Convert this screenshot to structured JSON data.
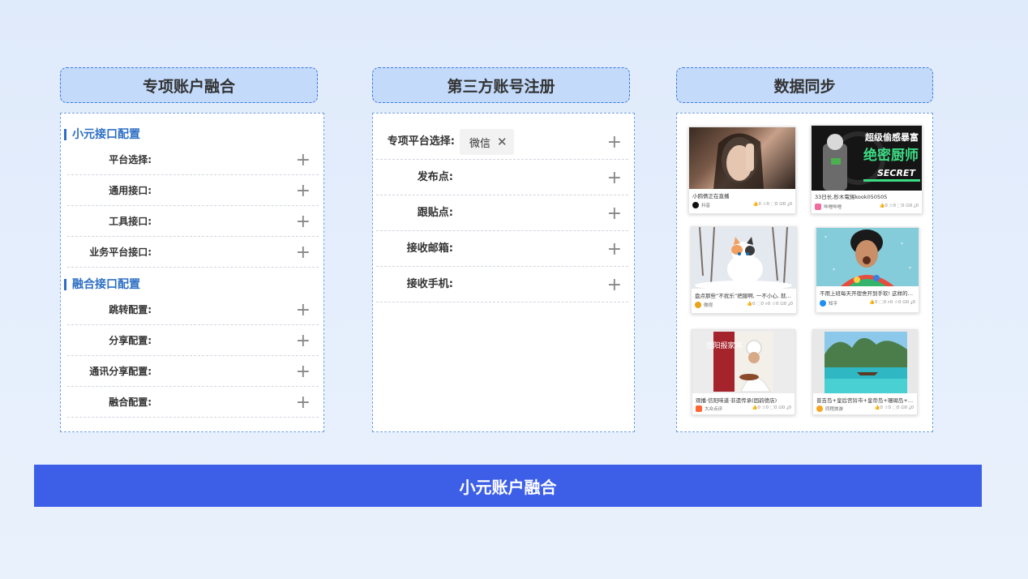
{
  "columns": {
    "account_fusion": {
      "title": "专项账户融合",
      "sections": [
        {
          "title": "小元接口配置",
          "items": [
            "平台选择:",
            "通用接口:",
            "工具接口:",
            "业务平台接口:"
          ]
        },
        {
          "title": "融合接口配置",
          "items": [
            "跳转配置:",
            "分享配置:",
            "通讯分享配置:",
            "融合配置:"
          ]
        }
      ]
    },
    "third_party": {
      "title": "第三方账号注册",
      "platform_label": "专项平台选择:",
      "platform_tag": "微信",
      "rows": [
        "发布点:",
        "跟贴点:",
        "接收邮箱:",
        "接收手机:"
      ]
    },
    "data_sync": {
      "title": "数据同步",
      "cards": [
        {
          "title": "小鸥倩正在直播",
          "source": "抖音",
          "stats": "👍0 ☆0 ⬚0 ⊡0 ⤓0",
          "icon_color": "#111111"
        },
        {
          "title": "33日长,秒木電錫kook050505",
          "source": "哔哩哔哩",
          "stats": "👍0 ☆0 ⬚0 ⊡0 ⤓0",
          "icon_color": "#f26ba0"
        },
        {
          "title": "盘点那些“不扰乐”把服啊, 一不小心, 就...",
          "source": "微视",
          "stats": "👍0 ⬚0 ⌕0 ☆0 ⊡0 ⤓0",
          "icon_color": "#e8a317"
        },
        {
          "title": "不用上班每天开宿舍开到手软! 这样的日子...",
          "source": "知乎",
          "stats": "👍0 ⬚0 ⌕0 ☆0 ⊡0 ⤓0",
          "icon_color": "#1f8ef1"
        },
        {
          "title": "观播·信阳味道·非遗传承(固韵德店)",
          "source": "大众点评",
          "stats": "👍0 ☆0 ⬚0 ⊡0 ⤓0",
          "icon_color": "#ff6633"
        },
        {
          "title": "普吉岛+皇后宫铃市+皇帝岛+珊瑚岛+大皇...",
          "source": "同程旅游",
          "stats": "👍0 ☆0 ⬚0 ⊡0 ⤓0",
          "icon_color": "#f5a623"
        }
      ],
      "card2_banner_line1": "超级偷感暴富",
      "card2_banner_line2": "绝密厨师",
      "card2_banner_line3": "SECRET",
      "card5_poster_text": "信阳报家鸡"
    }
  },
  "footer": {
    "label": "小元账户融合"
  },
  "colors": {
    "accent": "#3d5fe8",
    "header_bg": "#c3dafb",
    "section_title": "#2d6fc4"
  }
}
